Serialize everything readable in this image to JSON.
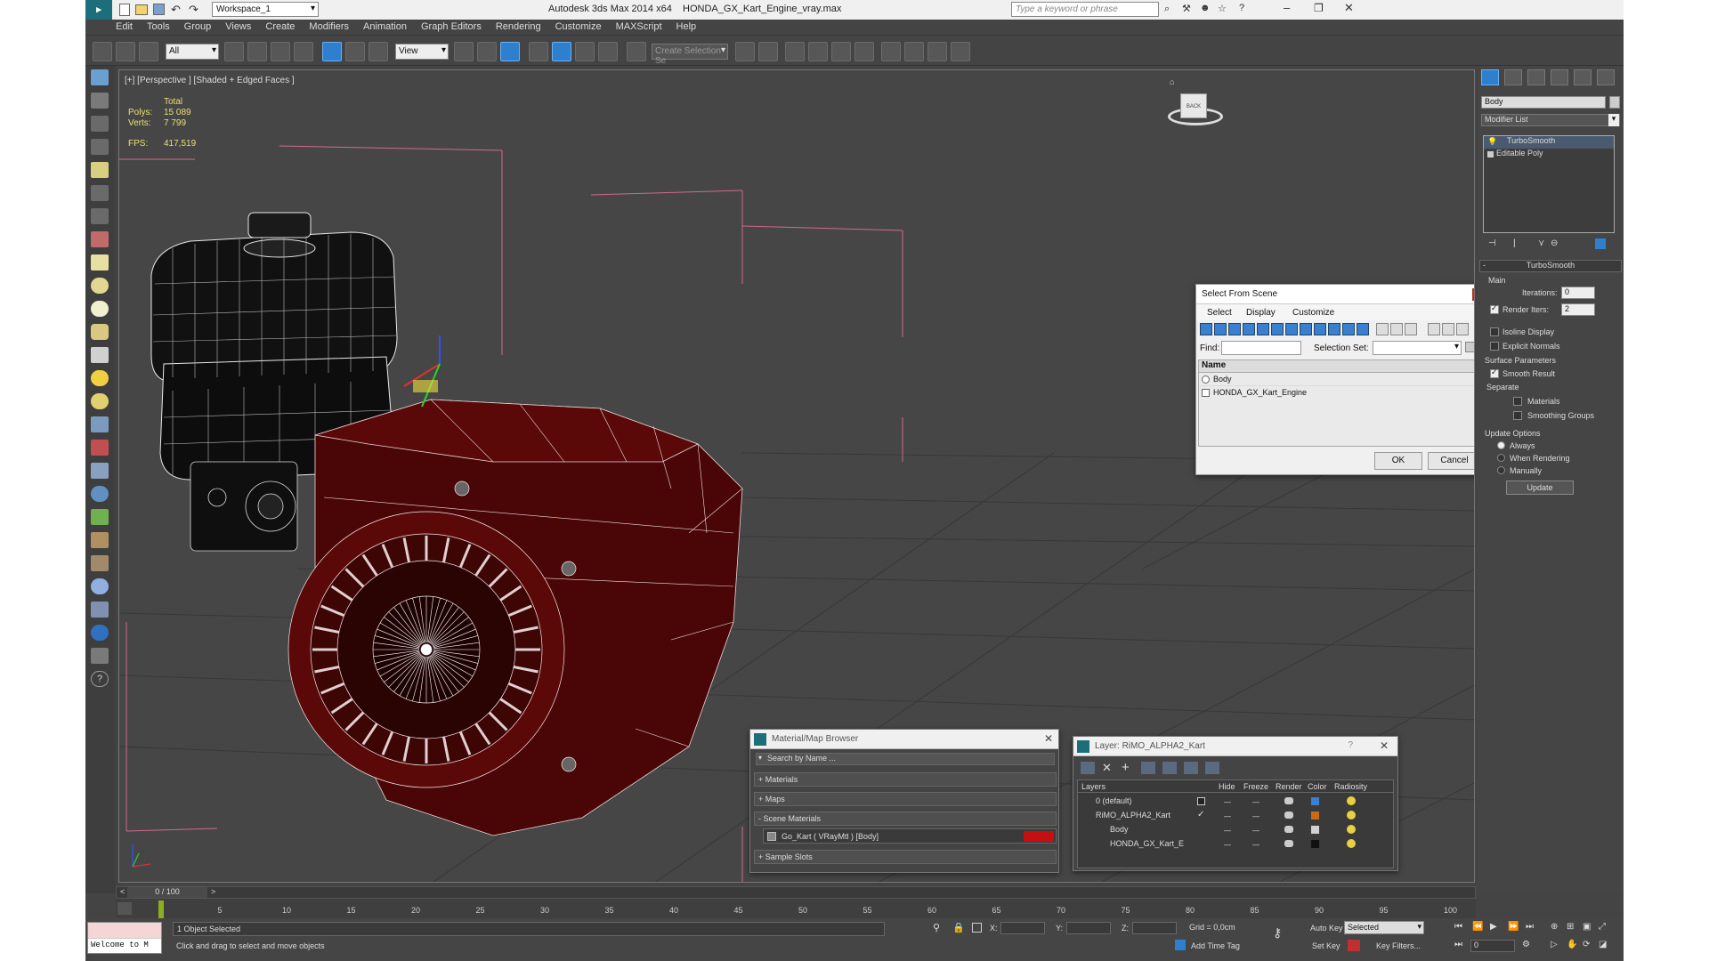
{
  "title": {
    "workspace": "Workspace_1",
    "app_name": "Autodesk 3ds Max  2014 x64",
    "file_name": "HONDA_GX_Kart_Engine_vray.max",
    "search_placeholder": "Type a keyword or phrase"
  },
  "menu": [
    "Edit",
    "Tools",
    "Group",
    "Views",
    "Create",
    "Modifiers",
    "Animation",
    "Graph Editors",
    "Rendering",
    "Customize",
    "MAXScript",
    "Help"
  ],
  "toolbar": {
    "filter_select": "All",
    "ref_coord": "View",
    "selection_set_placeholder": "Create Selection Se"
  },
  "viewport": {
    "label": "[+] [Perspective ] [Shaded + Edged Faces ]",
    "stats": {
      "total_label": "Total",
      "polys_label": "Polys:",
      "polys_value": "15 089",
      "verts_label": "Verts:",
      "verts_value": "7 799",
      "fps_label": "FPS:",
      "fps_value": "417,519"
    },
    "viewcube_label": "BACK"
  },
  "select_from_scene": {
    "title": "Select From Scene",
    "menus": [
      "Select",
      "Display",
      "Customize"
    ],
    "find_label": "Find:",
    "selection_set_label": "Selection Set:",
    "column_name": "Name",
    "items": [
      "Body",
      "HONDA_GX_Kart_Engine"
    ],
    "ok": "OK",
    "cancel": "Cancel"
  },
  "material_browser": {
    "title": "Material/Map Browser",
    "search_placeholder": "Search by Name ...",
    "groups": [
      {
        "sign": "+",
        "label": "Materials"
      },
      {
        "sign": "+",
        "label": "Maps"
      },
      {
        "sign": "-",
        "label": "Scene Materials"
      }
    ],
    "scene_material": "Go_Kart  ( VRayMtl )  [Body]",
    "sample_slots": "Sample Slots",
    "swatch_color": "#c41010"
  },
  "layer_dialog": {
    "title": "Layer: RiMO_ALPHA2_Kart",
    "help": "?",
    "columns": [
      "Layers",
      "Hide",
      "Freeze",
      "Render",
      "Color",
      "Radiosity"
    ],
    "rows": [
      {
        "name": "0 (default)",
        "color": "#3a7fd0"
      },
      {
        "name": "RiMO_ALPHA2_Kart",
        "color": "#c86a1a"
      },
      {
        "name": "Body",
        "color": "#d0d0d0"
      },
      {
        "name": "HONDA_GX_Kart_E",
        "color": "#111111"
      }
    ]
  },
  "command_panel": {
    "object_name": "Body",
    "modifier_list": "Modifier List",
    "stack": [
      "TurboSmooth",
      "Editable Poly"
    ],
    "rollout_title": "TurboSmooth",
    "main_label": "Main",
    "iterations_label": "Iterations:",
    "iterations_value": "0",
    "render_iters_label": "Render Iters:",
    "render_iters_value": "2",
    "isoline_display": "Isoline Display",
    "explicit_normals": "Explicit Normals",
    "surface_params": "Surface Parameters",
    "smooth_result": "Smooth Result",
    "separate": "Separate",
    "materials": "Materials",
    "smoothing_groups": "Smoothing Groups",
    "update_options": "Update Options",
    "always": "Always",
    "when_rendering": "When Rendering",
    "manually": "Manually",
    "update_button": "Update"
  },
  "timeline": {
    "frame_display": "0 / 100",
    "ticks": [
      "5",
      "10",
      "15",
      "20",
      "25",
      "30",
      "35",
      "40",
      "45",
      "50",
      "55",
      "60",
      "65",
      "70",
      "75",
      "80",
      "85",
      "90",
      "95",
      "100"
    ]
  },
  "status": {
    "maxscript": "Welcome to M",
    "selected": "1 Object Selected",
    "prompt": "Click and drag to select and move objects",
    "x_label": "X:",
    "y_label": "Y:",
    "z_label": "Z:",
    "grid": "Grid = 0,0cm",
    "add_time_tag": "Add Time Tag",
    "auto_key": "Auto Key",
    "selected_dropdown": "Selected",
    "set_key": "Set Key",
    "key_filters": "Key Filters...",
    "frame_value": "0"
  }
}
